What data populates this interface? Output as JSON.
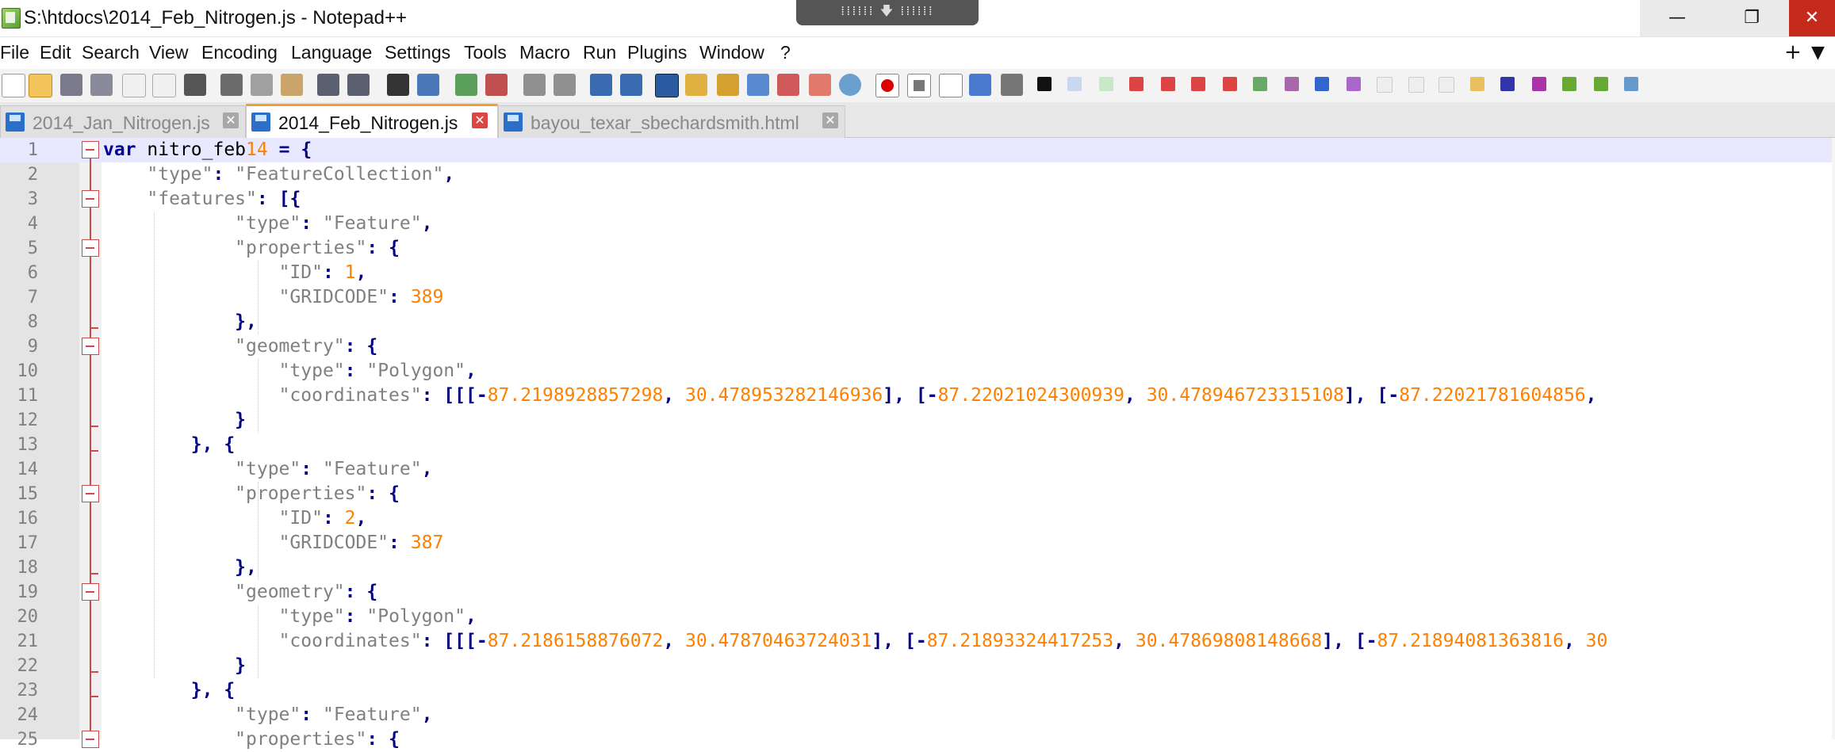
{
  "window": {
    "title": "S:\\htdocs\\2014_Feb_Nitrogen.js - Notepad++",
    "grip_label": "⁞⁞⁞⁞⁞⁞ 🡇 ⁞⁞⁞⁞⁞⁞",
    "minimize_glyph": "—",
    "maximize_glyph": "❐",
    "close_glyph": "✕"
  },
  "menu": {
    "items": [
      "File",
      "Edit",
      "Search",
      "View",
      "Encoding",
      "Language",
      "Settings",
      "Tools",
      "Macro",
      "Run",
      "Plugins",
      "Window",
      "?"
    ],
    "right_plus": "+",
    "right_arrow": "▼"
  },
  "tabs": [
    {
      "label": "2014_Jan_Nitrogen.js",
      "active": false
    },
    {
      "label": "2014_Feb_Nitrogen.js",
      "active": true
    },
    {
      "label": "bayou_texar_sbechardsmith.html",
      "active": false
    }
  ],
  "tab_close_glyph": "✕",
  "editor": {
    "current_line": 1,
    "line_numbers": [
      "1",
      "2",
      "3",
      "4",
      "5",
      "6",
      "7",
      "8",
      "9",
      "10",
      "11",
      "12",
      "13",
      "14",
      "15",
      "16",
      "17",
      "18",
      "19",
      "20",
      "21",
      "22",
      "23",
      "24",
      "25"
    ],
    "lines": [
      "var nitro_feb14 = {",
      "    \"type\": \"FeatureCollection\",",
      "    \"features\": [{",
      "            \"type\": \"Feature\",",
      "            \"properties\": {",
      "                \"ID\": 1,",
      "                \"GRIDCODE\": 389",
      "            },",
      "            \"geometry\": {",
      "                \"type\": \"Polygon\",",
      "                \"coordinates\": [[[-87.2198928857298, 30.478953282146936], [-87.22021024300939, 30.478946723315108], [-87.22021781604856,",
      "            }",
      "        }, {",
      "            \"type\": \"Feature\",",
      "            \"properties\": {",
      "                \"ID\": 2,",
      "                \"GRIDCODE\": 387",
      "            },",
      "            \"geometry\": {",
      "                \"type\": \"Polygon\",",
      "                \"coordinates\": [[[-87.2186158876072, 30.47870463724031], [-87.21893324417253, 30.47869808148668], [-87.21894081363816, 30",
      "            }",
      "        }, {",
      "            \"type\": \"Feature\",",
      "            \"properties\": {"
    ]
  }
}
